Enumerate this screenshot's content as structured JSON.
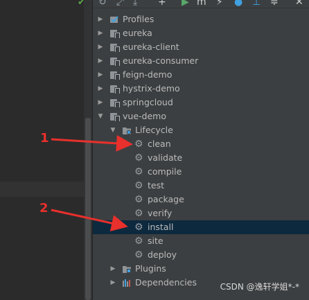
{
  "toolbar": {
    "icons": [
      "refresh-icon",
      "generate-icon",
      "download-icon",
      "add-icon",
      "run-icon",
      "execute-goal-icon",
      "toggle-offline-icon",
      "skip-tests-icon",
      "show-dependencies-icon",
      "collapse-all-icon",
      "settings-icon"
    ]
  },
  "tree": {
    "profiles_label": "Profiles",
    "modules": [
      {
        "label": "eureka"
      },
      {
        "label": "eureka-client"
      },
      {
        "label": "eureka-consumer"
      },
      {
        "label": "feign-demo"
      },
      {
        "label": "hystrix-demo"
      },
      {
        "label": "springcloud"
      },
      {
        "label": "vue-demo"
      }
    ],
    "lifecycle_label": "Lifecycle",
    "phases": [
      "clean",
      "validate",
      "compile",
      "test",
      "package",
      "verify",
      "install",
      "site",
      "deploy"
    ],
    "selected_phase": "install",
    "plugins_label": "Plugins",
    "dependencies_label": "Dependencies"
  },
  "annotations": {
    "first": "1",
    "second": "2",
    "color": "#e8302c"
  },
  "watermark": "CSDN @逸轩学姐*-*"
}
